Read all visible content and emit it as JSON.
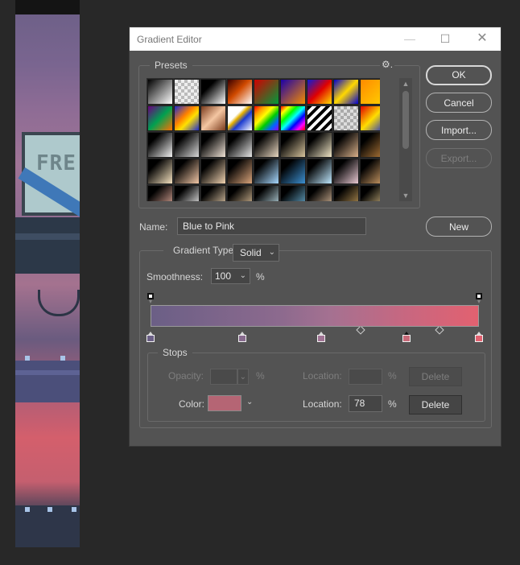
{
  "canvas": {
    "sign_text": "FRE"
  },
  "dialog": {
    "title": "Gradient Editor",
    "window_buttons": {
      "minimize": "—",
      "maximize": "☐",
      "close": "✕"
    },
    "presets": {
      "label": "Presets",
      "gear": "⚙.",
      "swatches": [
        "linear-gradient(135deg,#000 0%,#fff 100%)",
        "repeating-conic-gradient(#bbb 0% 25%, #eee 0% 50%) 0 0/8px 8px",
        "linear-gradient(135deg,#000 30%,#fff 100%)",
        "linear-gradient(135deg,#3a0000 0%,#d04a00 45%,#fff 100%)",
        "linear-gradient(135deg,#d00000 0%,#009a3a 100%)",
        "linear-gradient(135deg,#1b00a8 0%,#f58c00 100%)",
        "linear-gradient(135deg,#0b1bd8 0%,#e00000 50%,#ffe000 100%)",
        "linear-gradient(135deg,#0000d0 0%,#ffd800 50%,#0000d0 100%)",
        "linear-gradient(135deg,#ff8a00 0%,#ffd000 100%)",
        "linear-gradient(135deg,#6a0080 0%,#00a050 50%,#ff7000 100%)",
        "linear-gradient(135deg,#1d2bd0 0%,#ff8000 40%,#ffe000 60%,#1d2bd0 100%)",
        "linear-gradient(135deg,#7a3a1c 0%,#f4c6a2 50%,#7a3a1c 100%)",
        "linear-gradient(135deg,#fff 35%,#e5b000 45%,#1a3ad0 60%,#fff 100%)",
        "linear-gradient(135deg,#ff0000,#ff9900,#ffff00,#00cc00,#0066ff,#9900ff)",
        "linear-gradient(135deg,#ff0000,#ffff00,#00ff00,#00ffff,#0000ff,#ff00ff,#ff0000)",
        "repeating-linear-gradient(135deg,#000 0 4px,#fff 4px 8px)",
        "repeating-conic-gradient(#aaa 0% 25%, #ddd 0% 50%) 0 0/8px 8px",
        "linear-gradient(135deg,#e00000 0%,#ffde00 50%,#1a2fd0 100%)",
        "linear-gradient(135deg,#000 25%,#f3f3f3 100%)",
        "linear-gradient(135deg,#000 25%,#d9d9d9 100%)",
        "linear-gradient(135deg,#000 25%,#f0e3d6 100%)",
        "linear-gradient(135deg,#000 25%,#e6e6e6 100%)",
        "linear-gradient(135deg,#000 25%,#e9d7c0 100%)",
        "linear-gradient(135deg,#000 25%,#d6c39c 100%)",
        "linear-gradient(135deg,#000 25%,#f1e6c6 100%)",
        "linear-gradient(135deg,#000 25%,#d9b08a 100%)",
        "linear-gradient(135deg,#000 25%,#b47a3a 100%)",
        "linear-gradient(135deg,#000 25%,#f6e2c0 100%)",
        "linear-gradient(135deg,#000 25%,#f2c7a6 100%)",
        "linear-gradient(135deg,#000 25%,#f0d2b0 100%)",
        "linear-gradient(135deg,#000 25%,#d9a47a 100%)",
        "linear-gradient(135deg,#000 25%,#a7d8ff 100%)",
        "linear-gradient(135deg,#000 25%,#3c8fd0 100%)",
        "linear-gradient(135deg,#000 25%,#bfe8ff 100%)",
        "linear-gradient(135deg,#000 25%,#e8c8d2 100%)",
        "linear-gradient(135deg,#000 25%,#d6a36a 100%)",
        "linear-gradient(135deg,#000 25%,#e8b0a0 100%)",
        "linear-gradient(135deg,#000 25%,#ffffff 100%)",
        "linear-gradient(135deg,#000 25%,#f0d6b4 100%)",
        "linear-gradient(135deg,#000 25%,#e6c8a0 100%)",
        "linear-gradient(135deg,#000 25%,#c7e6f0 100%)",
        "linear-gradient(135deg,#000 25%,#6db4d8 100%)",
        "linear-gradient(135deg,#000 25%,#e0c0a0 100%)",
        "linear-gradient(135deg,#000 25%,#c09a5a 100%)",
        "linear-gradient(135deg,#000 25%,#e2c890 100%)"
      ]
    },
    "buttons": {
      "ok": "OK",
      "cancel": "Cancel",
      "import": "Import...",
      "export": "Export...",
      "new": "New"
    },
    "name": {
      "label": "Name:",
      "value": "Blue to Pink"
    },
    "gradient": {
      "type_label": "Gradient Type:",
      "type_value": "Solid",
      "smoothness_label": "Smoothness:",
      "smoothness_value": "100",
      "smoothness_unit": "%",
      "bar_gradient": "linear-gradient(90deg,#6b5f86 0%,#8d6a8e 40%,#a57191 55%,#c86780 78%,#e26170 100%)",
      "opacity_stops": [
        0,
        100
      ],
      "color_stops": [
        {
          "location": 0,
          "color": "#6b5f86"
        },
        {
          "location": 28,
          "color": "#876a8d"
        },
        {
          "location": 52,
          "color": "#a07394"
        },
        {
          "location": 78,
          "color": "#c86978",
          "selected": true
        },
        {
          "location": 100,
          "color": "#e26170"
        }
      ],
      "midpoints": [
        64,
        88
      ]
    },
    "stops": {
      "label": "Stops",
      "opacity_label": "Opacity:",
      "opacity_unit": "%",
      "opacity_location_label": "Location:",
      "opacity_location_unit": "%",
      "opacity_delete": "Delete",
      "color_label": "Color:",
      "color_value": "#b56574",
      "color_location_label": "Location:",
      "color_location_value": "78",
      "color_location_unit": "%",
      "color_delete": "Delete"
    }
  }
}
